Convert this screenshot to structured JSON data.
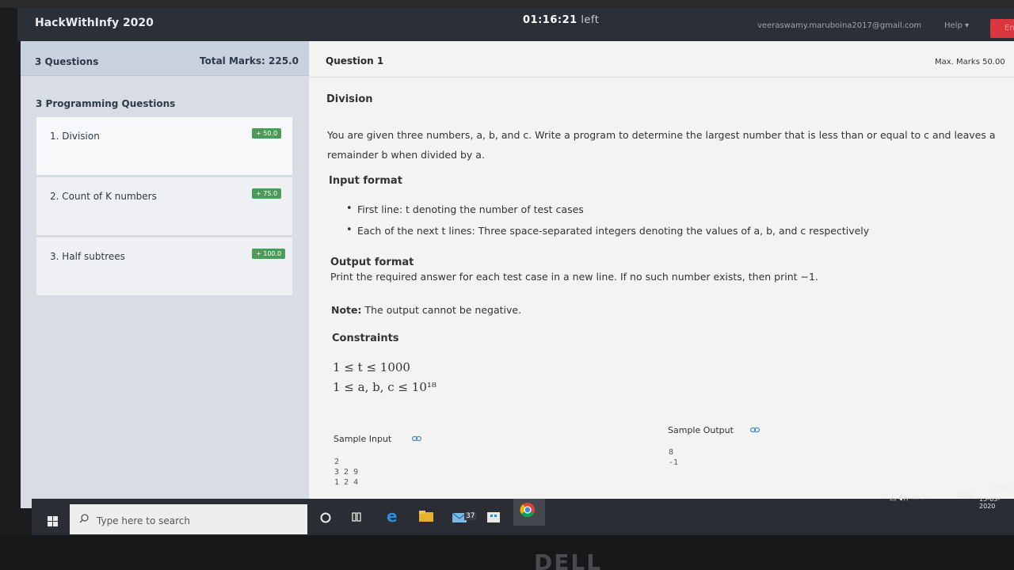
{
  "header": {
    "brand": "HackWithInfy 2020",
    "timer_value": "01:16:21",
    "timer_suffix": "left",
    "user_email": "veeraswamy.maruboina2017@gmail.com",
    "help_label": "Help ▾",
    "end_label": "En"
  },
  "sidebar": {
    "question_count": "3 Questions",
    "total_marks": "Total Marks: 225.0",
    "section_label": "3 Programming Questions",
    "items": [
      {
        "label": "1. Division",
        "badge": "+ 50.0"
      },
      {
        "label": "2. Count of K numbers",
        "badge": "+ 75.0"
      },
      {
        "label": "3. Half subtrees",
        "badge": "+ 100.0"
      }
    ]
  },
  "question": {
    "number_label": "Question  1",
    "max_marks": "Max. Marks 50.00",
    "title": "Division",
    "statement_1": "You are given three numbers, a, b, and c. Write a program to determine the largest number that is less than or equal to c and leaves a",
    "statement_2": "remainder b when divided by a.",
    "input_format_heading": "Input format",
    "input_bullets": [
      "First line: t denoting the number of test cases",
      "Each of the next t lines: Three space-separated integers denoting the values of a, b,  and c respectively"
    ],
    "output_format_heading": "Output format",
    "output_text": "Print the required answer for each test case in a new line. If no such number exists, then print −1.",
    "note_label": "Note:",
    "note_text": " The output cannot be negative.",
    "constraints_heading": "Constraints",
    "constraint_1": "1 ≤ t ≤ 1000",
    "constraint_2": "1 ≤ a, b, c ≤ 10¹⁸",
    "sample_input_label": "Sample Input",
    "sample_input": "2\n3 2 9\n1 2 4",
    "sample_output_label": "Sample Output",
    "sample_output": "8\n-1"
  },
  "taskbar": {
    "search_placeholder": "Type here to search",
    "mail_badge": "37",
    "lang": "ENG",
    "time": "17:35",
    "date": "15-03-2020"
  },
  "colors": {
    "topbar": "#2b2f36",
    "badge_green": "#4c9b58",
    "end_red": "#d9363e"
  }
}
